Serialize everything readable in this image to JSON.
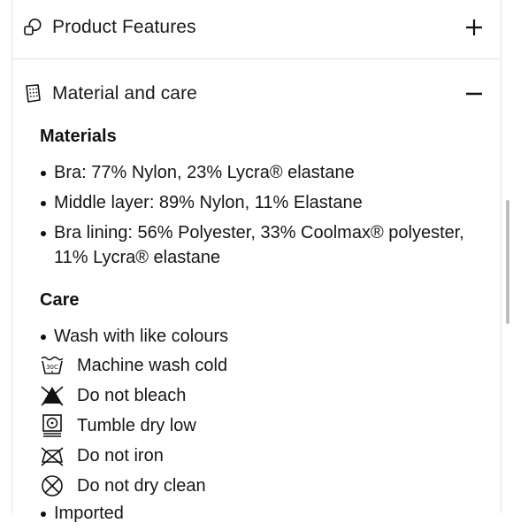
{
  "accordion": {
    "features": {
      "title": "Product Features",
      "icon": "shapes-icon",
      "toggle": "plus-icon"
    },
    "material": {
      "title": "Material and care",
      "icon": "fabric-tag-icon",
      "toggle": "minus-icon"
    }
  },
  "materials": {
    "heading": "Materials",
    "items": [
      "Bra: 77% Nylon, 23% Lycra® elastane",
      "Middle layer: 89% Nylon, 11% Elastane",
      "Bra lining: 56% Polyester, 33% Coolmax® polyester, 11% Lycra® elastane"
    ]
  },
  "care": {
    "heading": "Care",
    "bullet": "Wash with like colours",
    "instructions": [
      {
        "icon": "machine-wash-cold-icon",
        "text": "Machine wash cold",
        "temp": "30C"
      },
      {
        "icon": "do-not-bleach-icon",
        "text": "Do not bleach"
      },
      {
        "icon": "tumble-dry-low-icon",
        "text": "Tumble dry low"
      },
      {
        "icon": "do-not-iron-icon",
        "text": "Do not iron"
      },
      {
        "icon": "do-not-dry-clean-icon",
        "text": "Do not dry clean"
      }
    ],
    "trailing_bullet": "Imported"
  },
  "colors": {
    "text": "#111111",
    "divider": "#e3e3e3",
    "scrollbar": "#bdbdbd"
  }
}
